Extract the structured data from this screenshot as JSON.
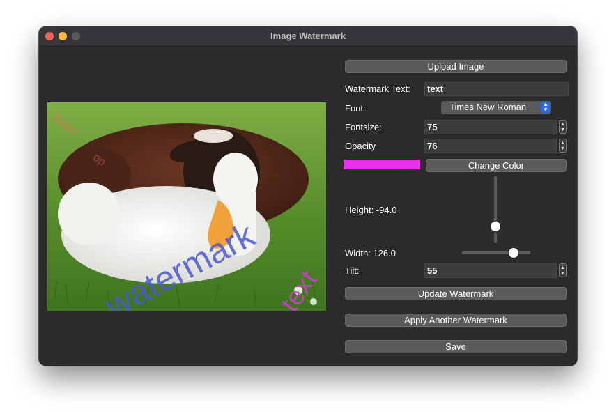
{
  "window": {
    "title": "Image Watermark"
  },
  "controls": {
    "upload_label": "Upload Image",
    "watermark_text_label": "Watermark Text:",
    "watermark_text_value": "text",
    "font_label": "Font:",
    "font_value": "Times New Roman",
    "fontsize_label": "Fontsize:",
    "fontsize_value": "75",
    "opacity_label": "Opacity",
    "opacity_value": "76",
    "color_hex": "#e633e6",
    "change_color_label": "Change Color",
    "height_label": "Height: -94.0",
    "height_slider_level": 0.25,
    "width_label": "Width: 126.0",
    "width_slider_level": 0.75,
    "tilt_label": "Tilt:",
    "tilt_value": "55",
    "update_label": "Update Watermark",
    "apply_another_label": "Apply Another Watermark",
    "save_label": "Save"
  },
  "preview": {
    "watermarks": [
      {
        "text": "New",
        "color": "#d9725a"
      },
      {
        "text": "watermark",
        "color": "#4b58d6"
      },
      {
        "text": "text",
        "color": "#d43ad4"
      }
    ],
    "partial_watermark": "op"
  },
  "colors": {
    "window_bg": "#2b2b2b",
    "button_bg": "#5b5b5e",
    "select_accent": "#2d6be0"
  }
}
